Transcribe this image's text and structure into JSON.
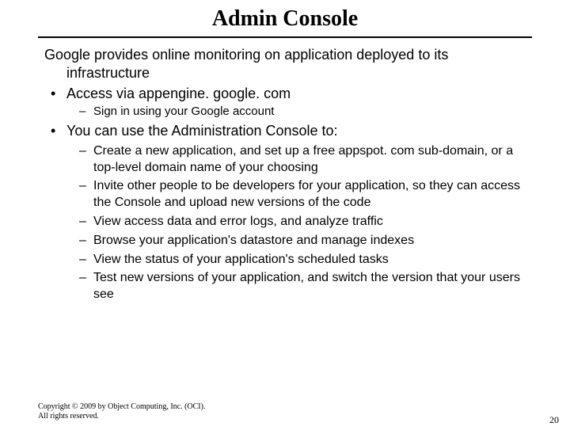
{
  "title": "Admin Console",
  "lead": "Google provides online monitoring on application deployed to its infrastructure",
  "bullets": [
    {
      "text": "Access via appengine. google. com",
      "sub": [
        "Sign in using your Google account"
      ]
    },
    {
      "text": "You can use the Administration Console to:",
      "sub": [
        "Create a new application, and set up a free appspot. com sub-domain, or a top-level domain name of your choosing",
        "Invite other people to be developers for your application, so they can access the Console and upload new versions of the code",
        "View access data and error logs, and analyze traffic",
        "Browse your application's datastore and manage indexes",
        "View the status of your application's scheduled tasks",
        "Test new versions of your application, and switch the version that your users see"
      ]
    }
  ],
  "footer": {
    "copyright_line1": "Copyright © 2009 by Object Computing, Inc. (OCI).",
    "copyright_line2": "All rights reserved.",
    "page_number": "20"
  }
}
